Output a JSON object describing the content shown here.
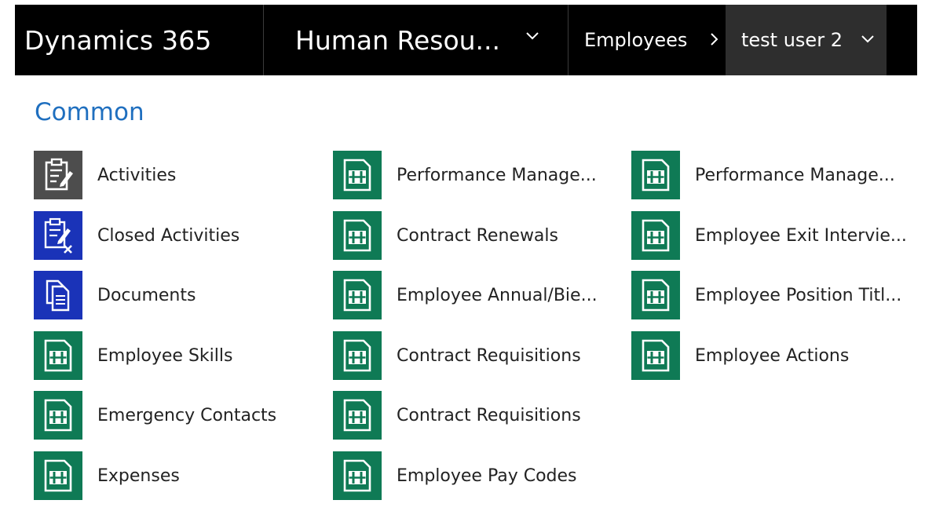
{
  "header": {
    "app_title": "Dynamics 365",
    "area_label": "Human Resou...",
    "breadcrumb_label": "Employees",
    "record_label": "test user 2"
  },
  "colors": {
    "nav_background": "#000000",
    "record_background": "#2e2e2e",
    "section_title": "#1f6fbf",
    "entity_tile": "#0f7a55",
    "activities_tile": "#4d4d4d",
    "blue_tile": "#1a33b8"
  },
  "section": {
    "title": "Common",
    "columns": [
      [
        {
          "label": "Activities",
          "icon": "activities-icon"
        },
        {
          "label": "Closed Activities",
          "icon": "closed-activities-icon"
        },
        {
          "label": "Documents",
          "icon": "documents-icon"
        },
        {
          "label": "Employee Skills",
          "icon": "entity-icon"
        },
        {
          "label": "Emergency Contacts",
          "icon": "entity-icon"
        },
        {
          "label": "Expenses",
          "icon": "entity-icon"
        }
      ],
      [
        {
          "label": "Performance Manage...",
          "icon": "entity-icon"
        },
        {
          "label": "Contract Renewals",
          "icon": "entity-icon"
        },
        {
          "label": "Employee Annual/Bie...",
          "icon": "entity-icon"
        },
        {
          "label": "Contract Requisitions",
          "icon": "entity-icon"
        },
        {
          "label": "Contract Requisitions",
          "icon": "entity-icon"
        },
        {
          "label": "Employee Pay Codes",
          "icon": "entity-icon"
        }
      ],
      [
        {
          "label": "Performance Manage...",
          "icon": "entity-icon"
        },
        {
          "label": "Employee Exit Intervie...",
          "icon": "entity-icon"
        },
        {
          "label": "Employee Position Titl...",
          "icon": "entity-icon"
        },
        {
          "label": "Employee Actions",
          "icon": "entity-icon"
        }
      ]
    ]
  }
}
